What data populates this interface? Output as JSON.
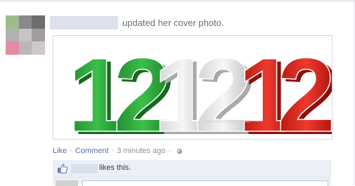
{
  "story": {
    "action_text": "updated her cover photo."
  },
  "avatar": {
    "mosaic_colors": [
      "#9cbc8e",
      "#8a8a8c",
      "#6e6e70",
      "#b5b0b2",
      "#c9c4c6",
      "#a29c9e",
      "#e48da2",
      "#bdb6b8",
      "#cec8ca"
    ]
  },
  "cover_photo": {
    "digits": [
      "1",
      "2",
      "1",
      "2",
      "1",
      "2"
    ],
    "digit_colors": [
      "#2aa63a",
      "#2aa63a",
      "#e8e8e8",
      "#e8e8e8",
      "#e3261f",
      "#e3261f"
    ],
    "watermark": "www.conceptpix.com"
  },
  "actions": {
    "like_label": "Like",
    "comment_label": "Comment",
    "timestamp": "3 minutes ago",
    "separator": "·",
    "privacy_icon": "globe-icon"
  },
  "likes": {
    "text": "likes this.",
    "icon": "thumbs-up-icon"
  },
  "colors": {
    "link": "#5a70a8",
    "muted": "#8c919b",
    "likes_bg": "#eceff5"
  }
}
